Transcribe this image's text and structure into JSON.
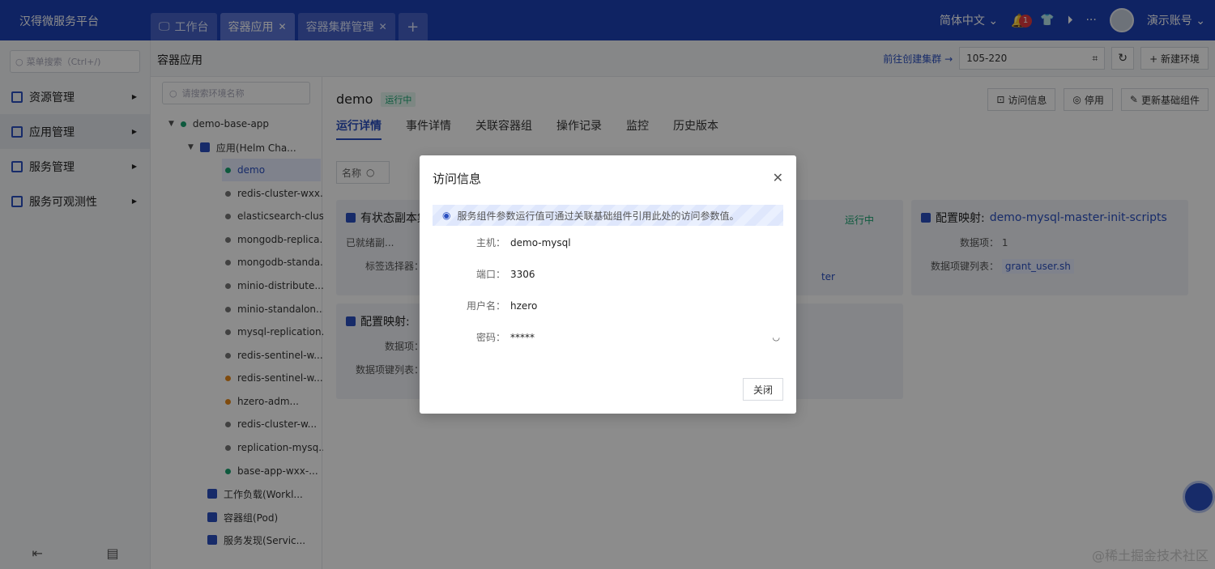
{
  "app": {
    "title": "汉得微服务平台"
  },
  "tabs": [
    {
      "label": "工作台",
      "closable": false
    },
    {
      "label": "容器应用",
      "closable": true
    },
    {
      "label": "容器集群管理",
      "closable": true
    }
  ],
  "topbar": {
    "language": "简体中文",
    "notifications": "1",
    "account": "演示账号"
  },
  "leftnav": {
    "search_placeholder": "菜单搜索（Ctrl+/)",
    "items": [
      {
        "label": "资源管理"
      },
      {
        "label": "应用管理"
      },
      {
        "label": "服务管理"
      },
      {
        "label": "服务可观测性"
      }
    ]
  },
  "page": {
    "title": "容器应用",
    "create_cluster_link": "前往创建集群 →",
    "cluster": "105-220",
    "new_env_label": "+ 新建环境"
  },
  "tree": {
    "search_placeholder": "请搜索环境名称",
    "items": [
      {
        "label": "demo-base-app"
      },
      {
        "label": "应用(Helm Cha..."
      },
      {
        "label": "demo"
      },
      {
        "label": "redis-cluster-wxx..."
      },
      {
        "label": "elasticsearch-clus..."
      },
      {
        "label": "mongodb-replica..."
      },
      {
        "label": "mongodb-standa..."
      },
      {
        "label": "minio-distribute..."
      },
      {
        "label": "minio-standalon..."
      },
      {
        "label": "mysql-replication..."
      },
      {
        "label": "redis-sentinel-w..."
      },
      {
        "label": "redis-sentinel-w..."
      },
      {
        "label": "hzero-adm..."
      },
      {
        "label": "redis-cluster-w..."
      },
      {
        "label": "replication-mysq..."
      },
      {
        "label": "base-app-wxx-..."
      },
      {
        "label": "工作负载(Workl..."
      },
      {
        "label": "容器组(Pod)"
      },
      {
        "label": "服务发现(Servic..."
      }
    ]
  },
  "detail": {
    "name": "demo",
    "status": "运行中",
    "actions": {
      "access_info": "访问信息",
      "stop": "停用",
      "update": "更新基础组件"
    },
    "tabs": [
      "运行详情",
      "事件详情",
      "关联容器组",
      "操作记录",
      "监控",
      "历史版本"
    ],
    "filter_label": "名称",
    "cards": [
      {
        "title": "有状态副本集",
        "kv1_label": "已就绪副...",
        "kv2_label": "标签选择器：",
        "status": "运行中",
        "tail": "ter"
      },
      {
        "title": "配置映射:",
        "name": "demo-mysql-master-init-scripts",
        "kv1_label": "数据项：",
        "kv1_value": "1",
        "kv2_label": "数据项键列表：",
        "kv2_value": "grant_user.sh"
      },
      {
        "title": "配置映射:",
        "kv1_label": "数据项：",
        "kv2_label": "数据项键列表："
      }
    ]
  },
  "modal": {
    "title": "访问信息",
    "info": "服务组件参数运行值可通过关联基础组件引用此处的访问参数值。",
    "fields": [
      {
        "label": "主机：",
        "value": "demo-mysql"
      },
      {
        "label": "端口：",
        "value": "3306"
      },
      {
        "label": "用户名：",
        "value": "hzero"
      },
      {
        "label": "密码：",
        "value": "*****"
      }
    ],
    "close_label": "关闭"
  },
  "credit": "@稀土掘金技术社区"
}
